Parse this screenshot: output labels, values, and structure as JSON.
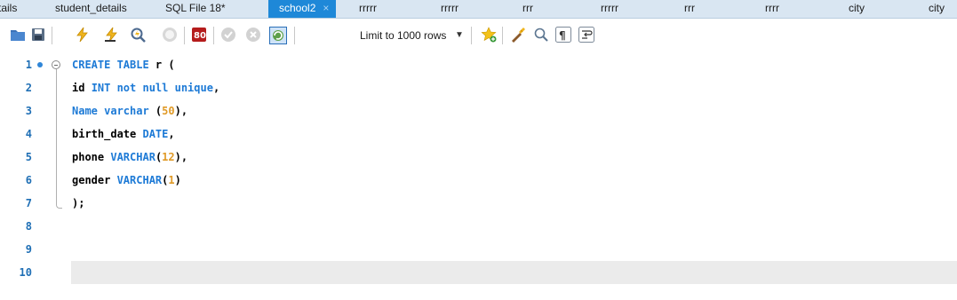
{
  "tabs": [
    {
      "label": "tails"
    },
    {
      "label": "student_details"
    },
    {
      "label": "SQL File 18*"
    },
    {
      "label": "school2",
      "active": true
    },
    {
      "label": "rrrrr"
    },
    {
      "label": "rrrrr"
    },
    {
      "label": "rrr"
    },
    {
      "label": "rrrrr"
    },
    {
      "label": "rrr"
    },
    {
      "label": "rrrr"
    },
    {
      "label": "city"
    },
    {
      "label": "city"
    }
  ],
  "tab_close_glyph": "×",
  "toolbar": {
    "icons": [
      "open-folder-icon",
      "save-icon",
      "execute-icon",
      "execute-current-icon",
      "explain-icon",
      "stop-icon",
      "toggle-error-icon",
      "commit-icon",
      "rollback-icon",
      "autocommit-icon",
      "add-snippet-icon",
      "beautify-icon",
      "find-icon",
      "invisibles-icon",
      "wrap-icon"
    ],
    "limit_label": "Limit to 1000 rows",
    "limit_arrow": "▼"
  },
  "editor": {
    "lines": [
      {
        "n": "1",
        "tokens": [
          {
            "t": "CREATE TABLE",
            "c": "kw"
          },
          {
            "t": " r (",
            "c": ""
          }
        ]
      },
      {
        "n": "2",
        "tokens": [
          {
            "t": "id ",
            "c": ""
          },
          {
            "t": "INT not null unique",
            "c": "kw"
          },
          {
            "t": ",",
            "c": ""
          }
        ]
      },
      {
        "n": "3",
        "tokens": [
          {
            "t": "Name varchar",
            "c": "kw"
          },
          {
            "t": " (",
            "c": ""
          },
          {
            "t": "50",
            "c": "num"
          },
          {
            "t": "),",
            "c": ""
          }
        ]
      },
      {
        "n": "4",
        "tokens": [
          {
            "t": "birth_date ",
            "c": ""
          },
          {
            "t": "DATE",
            "c": "kw"
          },
          {
            "t": ",",
            "c": ""
          }
        ]
      },
      {
        "n": "5",
        "tokens": [
          {
            "t": "phone ",
            "c": ""
          },
          {
            "t": "VARCHAR",
            "c": "kw"
          },
          {
            "t": "(",
            "c": ""
          },
          {
            "t": "12",
            "c": "num"
          },
          {
            "t": "),",
            "c": ""
          }
        ]
      },
      {
        "n": "6",
        "tokens": [
          {
            "t": "gender ",
            "c": ""
          },
          {
            "t": "VARCHAR",
            "c": "kw"
          },
          {
            "t": "(",
            "c": ""
          },
          {
            "t": "1",
            "c": "num"
          },
          {
            "t": ")",
            "c": ""
          }
        ]
      },
      {
        "n": "7",
        "tokens": [
          {
            "t": ");",
            "c": ""
          }
        ]
      },
      {
        "n": "8",
        "tokens": []
      },
      {
        "n": "9",
        "tokens": []
      },
      {
        "n": "10",
        "tokens": [],
        "current": true
      }
    ]
  },
  "colors": {
    "tab_active": "#1e88d8",
    "tabbar_bg": "#d9e6f2",
    "keyword": "#1d7ad6",
    "number": "#e09a27",
    "line_number": "#1f6fb5",
    "current_line": "#ebebeb"
  }
}
